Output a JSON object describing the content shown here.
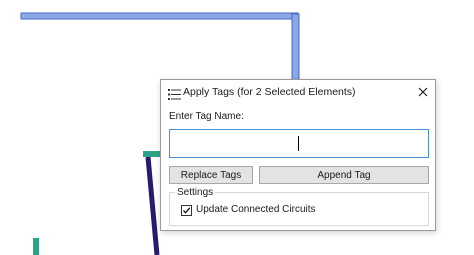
{
  "dialog": {
    "title": "Apply Tags (for 2 Selected Elements)",
    "title_icon": "list-icon",
    "close_icon": "close-icon",
    "tag_label": "Enter Tag Name:",
    "tag_input": {
      "value": "",
      "placeholder": ""
    },
    "replace_button": "Replace Tags",
    "append_button": "Append Tag",
    "settings": {
      "legend": "Settings",
      "update_connected_circuits": {
        "label": "Update Connected Circuits",
        "checked": true
      }
    }
  },
  "colors": {
    "pipe_blue": "#8aa7e6",
    "pipe_blue_outline": "#4a66c8",
    "teal_element": "#2ba38a",
    "purple_line": "#2a1a6e",
    "input_focus_border": "#4a90d9"
  }
}
